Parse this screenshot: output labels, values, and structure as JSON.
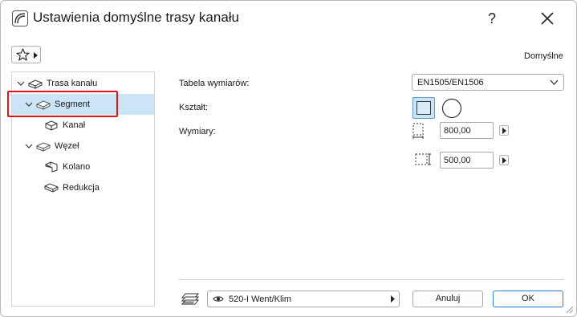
{
  "window": {
    "title": "Ustawienia domyślne trasy kanału",
    "help_label": "?"
  },
  "toolbar": {
    "defaults_label": "Domyślne"
  },
  "tree": {
    "items": [
      {
        "label": "Trasa kanału",
        "expanded": true,
        "icon": "duct-route-icon"
      },
      {
        "label": "Segment",
        "expanded": true,
        "selected": true,
        "icon": "segment-icon"
      },
      {
        "label": "Kanał",
        "icon": "duct-icon"
      },
      {
        "label": "Węzeł",
        "expanded": true,
        "icon": "node-icon"
      },
      {
        "label": "Kolano",
        "icon": "elbow-icon"
      },
      {
        "label": "Redukcja",
        "icon": "reducer-icon"
      }
    ]
  },
  "form": {
    "table_label": "Tabela wymiarów:",
    "table_value": "EN1505/EN1506",
    "shape_label": "Kształt:",
    "shape_options": [
      "rectangle",
      "circle"
    ],
    "shape_selected": "rectangle",
    "dimensions_label": "Wymiary:",
    "width_value": "800,00",
    "height_value": "500,00"
  },
  "footer": {
    "layer_value": "520-I Went/Klim",
    "cancel_label": "Anuluj",
    "ok_label": "OK"
  },
  "colors": {
    "selection": "#cce4f7",
    "highlight": "#e0161b",
    "primary_border": "#2f7fd0"
  }
}
